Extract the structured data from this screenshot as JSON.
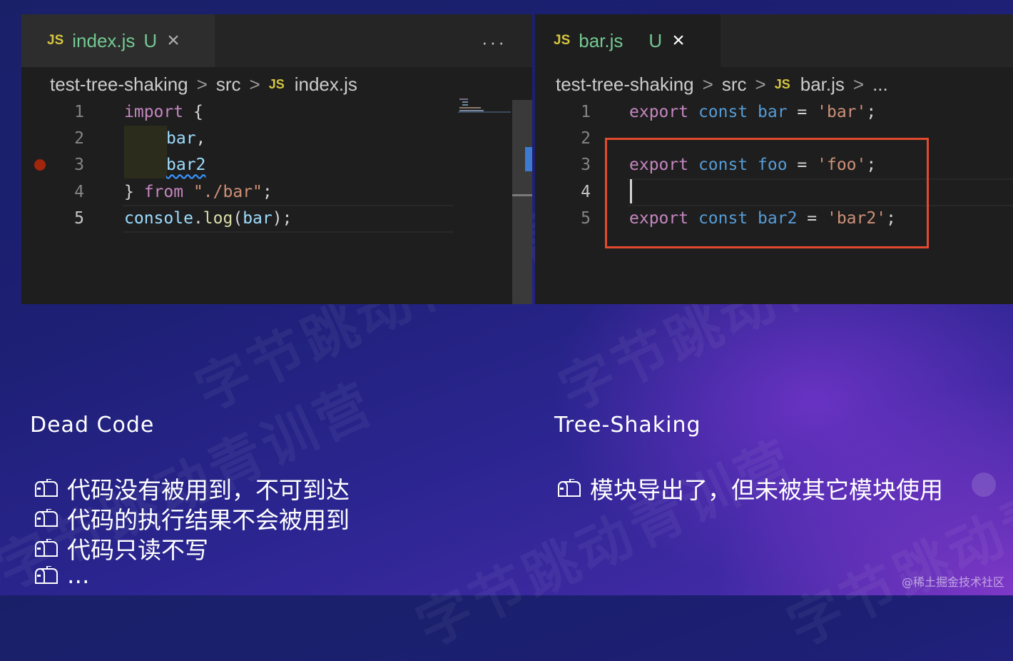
{
  "left_editor": {
    "tab": {
      "icon_label": "JS",
      "file_name": "index.js",
      "status": "U",
      "close": "×"
    },
    "more_actions": "···",
    "breadcrumb": {
      "folder": "test-tree-shaking",
      "sep": ">",
      "subfolder": "src",
      "icon_label": "JS",
      "file": "index.js"
    },
    "lines": [
      {
        "num": "1",
        "parts": [
          "import",
          " {"
        ]
      },
      {
        "num": "2",
        "parts": [
          "bar",
          ","
        ]
      },
      {
        "num": "3",
        "parts": [
          "bar2"
        ]
      },
      {
        "num": "4",
        "parts": [
          "}",
          " from",
          " \"./bar\"",
          ";"
        ]
      },
      {
        "num": "5",
        "parts": [
          "console",
          ".",
          "log",
          "(",
          "bar",
          ");"
        ]
      }
    ]
  },
  "right_editor": {
    "tab": {
      "icon_label": "JS",
      "file_name": "bar.js",
      "status": "U",
      "close": "×"
    },
    "breadcrumb": {
      "folder": "test-tree-shaking",
      "sep": ">",
      "subfolder": "src",
      "icon_label": "JS",
      "file": "bar.js",
      "more": "..."
    },
    "lines": [
      {
        "num": "1",
        "parts": [
          "export",
          " const",
          " bar",
          " =",
          " 'bar'",
          ";"
        ]
      },
      {
        "num": "2",
        "parts": []
      },
      {
        "num": "3",
        "parts": [
          "export",
          " const",
          " foo",
          " =",
          " 'foo'",
          ";"
        ]
      },
      {
        "num": "4",
        "parts": []
      },
      {
        "num": "5",
        "parts": [
          "export",
          " const",
          " bar2",
          " =",
          " 'bar2'",
          ";"
        ]
      }
    ]
  },
  "slide": {
    "left_heading": "Dead Code",
    "left_bullets": [
      "代码没有被用到，不可到达",
      "代码的执行结果不会被用到",
      "代码只读不写",
      "..."
    ],
    "right_heading": "Tree-Shaking",
    "right_bullets": [
      "模块导出了，但未被其它模块使用"
    ],
    "watermark": "字节跳动青训营",
    "credit": "@稀土掘金技术社区"
  },
  "colors": {
    "highlight_box": "#e24a2f",
    "tab_modified": "#73c991",
    "breakpoint": "#a1260d"
  },
  "icons": [
    "mailbox-icon",
    "close-icon",
    "more-actions-icon",
    "breakpoint-icon"
  ]
}
